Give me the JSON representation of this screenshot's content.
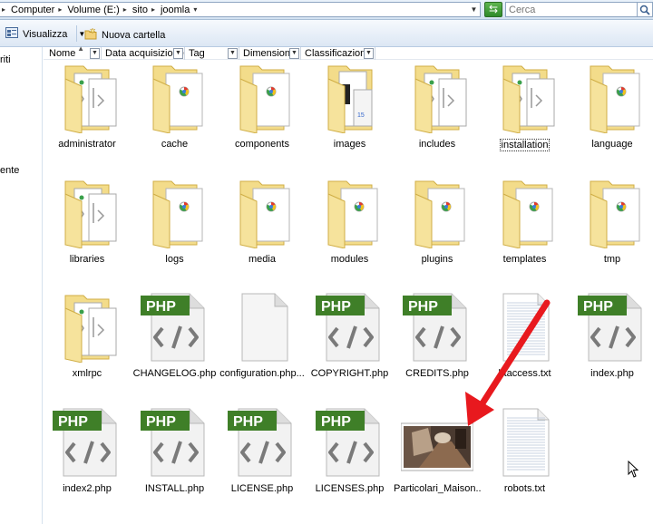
{
  "address": {
    "crumbs": [
      "Computer",
      "Volume (E:)",
      "sito",
      "joomla"
    ],
    "search_placeholder": "Cerca"
  },
  "toolbar": {
    "view_label": "Visualizza",
    "new_folder_label": "Nuova cartella"
  },
  "nav": {
    "items": [
      "riti",
      "ente"
    ]
  },
  "columns": [
    "Nome",
    "Data acquisizione",
    "Tag",
    "Dimensione",
    "Classificazione"
  ],
  "files": [
    {
      "name": "administrator",
      "kind": "folder-code"
    },
    {
      "name": "cache",
      "kind": "folder"
    },
    {
      "name": "components",
      "kind": "folder"
    },
    {
      "name": "images",
      "kind": "folder-images"
    },
    {
      "name": "includes",
      "kind": "folder-code"
    },
    {
      "name": "installation",
      "kind": "folder-code"
    },
    {
      "name": "language",
      "kind": "folder"
    },
    {
      "name": "libraries",
      "kind": "folder-code"
    },
    {
      "name": "logs",
      "kind": "folder"
    },
    {
      "name": "media",
      "kind": "folder"
    },
    {
      "name": "modules",
      "kind": "folder"
    },
    {
      "name": "plugins",
      "kind": "folder"
    },
    {
      "name": "templates",
      "kind": "folder"
    },
    {
      "name": "tmp",
      "kind": "folder"
    },
    {
      "name": "xmlrpc",
      "kind": "folder-code"
    },
    {
      "name": "CHANGELOG.php",
      "kind": "php"
    },
    {
      "name": "configuration.php...",
      "kind": "blank"
    },
    {
      "name": "COPYRIGHT.php",
      "kind": "php"
    },
    {
      "name": "CREDITS.php",
      "kind": "php"
    },
    {
      "name": "htaccess.txt",
      "kind": "text"
    },
    {
      "name": "index.php",
      "kind": "php"
    },
    {
      "name": "index2.php",
      "kind": "php"
    },
    {
      "name": "INSTALL.php",
      "kind": "php"
    },
    {
      "name": "LICENSE.php",
      "kind": "php"
    },
    {
      "name": "LICENSES.php",
      "kind": "php"
    },
    {
      "name": "Particolari_Maison...",
      "kind": "photo"
    },
    {
      "name": "robots.txt",
      "kind": "text"
    }
  ],
  "php_badge": "PHP",
  "annotation_color": "#e8191e",
  "folder_color": "#f3dc8a"
}
